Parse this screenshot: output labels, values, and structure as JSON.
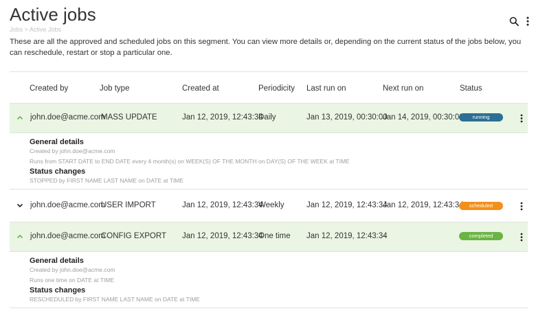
{
  "header": {
    "title": "Active jobs",
    "breadcrumb": [
      "Jobs",
      ">",
      "Active Jobs"
    ],
    "description": "These are all the approved and scheduled jobs on this segment. You can view more details or, depending on the current status of the jobs below, you can reschedule, restart or stop a particular one."
  },
  "columns": [
    "Created by",
    "Job type",
    "Created at",
    "Periodicity",
    "Last run on",
    "Next run on",
    "Status"
  ],
  "jobs": [
    {
      "created_by": "john.doe@acme.com",
      "job_type": "MASS UPDATE",
      "created_at": "Jan 12, 2019, 12:43:34",
      "periodicity": "Daily",
      "last_run": "Jan 13, 2019, 00:30:00",
      "next_run": "Jan 14, 2019, 00:30:00",
      "status": "running",
      "status_color": "#2b6f94",
      "expanded": true,
      "details": {
        "general_title": "General details",
        "created_line": "Created by john.doe@acme.com",
        "runs_line": "Runs from START DATE to END DATE every 4 month(s) on WEEK(S) OF THE MONTH on DAY(S) OF THE WEEK at TIME",
        "status_title": "Status changes",
        "status_line": "STOPPED by FIRST NAME LAST NAME on DATE at TIME"
      }
    },
    {
      "created_by": "john.doe@acme.com",
      "job_type": "USER IMPORT",
      "created_at": "Jan 12, 2019, 12:43:34",
      "periodicity": "Weekly",
      "last_run": "Jan 12, 2019, 12:43:34",
      "next_run": "Jan 12, 2019, 12:43:34",
      "status": "scheduled",
      "status_color": "#f39019",
      "expanded": false
    },
    {
      "created_by": "john.doe@acme.com",
      "job_type": "CONFIG EXPORT",
      "created_at": "Jan 12, 2019, 12:43:34",
      "periodicity": "One time",
      "last_run": "Jan 12, 2019, 12:43:34",
      "next_run": "-",
      "status": "completed",
      "status_color": "#6ab444",
      "expanded": true,
      "details": {
        "general_title": "General details",
        "created_line": "Created by john.doe@acme.com",
        "runs_line": "Runs one time on DATE at TIME",
        "status_title": "Status changes",
        "status_line": "RESCHEDULED by FIRST NAME LAST NAME on DATE at TIME"
      }
    }
  ],
  "icons": {
    "search": "search-icon",
    "more": "more-vertical-icon",
    "expanded": "chevron-up-icon",
    "collapsed": "chevron-down-icon"
  },
  "colors": {
    "expanded_row_bg": "#eaf5e4",
    "chevron_green": "#6ab444"
  }
}
